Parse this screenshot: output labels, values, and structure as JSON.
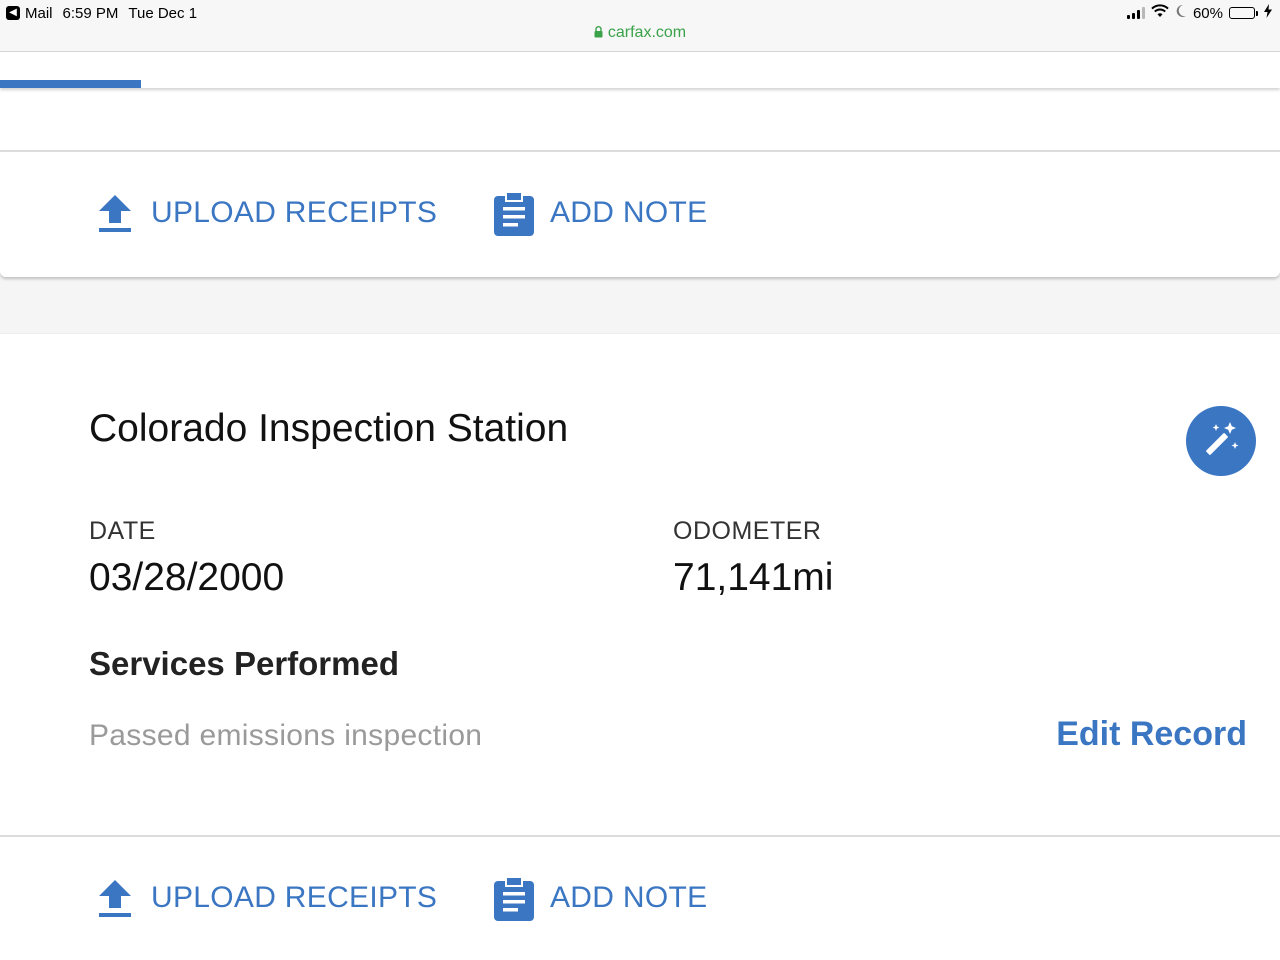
{
  "status_bar": {
    "app": "Mail",
    "time": "6:59 PM",
    "date": "Tue Dec 1",
    "battery": "60%",
    "battery_level": 0.6,
    "url": "carfax.com"
  },
  "progress": {
    "fraction": 0.11
  },
  "actions": {
    "upload_label": "UPLOAD RECEIPTS",
    "note_label": "ADD NOTE"
  },
  "record": {
    "title": "Colorado Inspection Station",
    "date_label": "DATE",
    "date_value": "03/28/2000",
    "odometer_label": "ODOMETER",
    "odometer_value": "71,141mi",
    "services_title": "Services Performed",
    "service_item": "Passed emissions inspection",
    "edit_label": "Edit Record"
  },
  "colors": {
    "accent": "#3b76c3",
    "url_green": "#3aa34a"
  },
  "icons": [
    "back-icon",
    "signal-icon",
    "wifi-icon",
    "moon-icon",
    "battery-icon",
    "charging-icon",
    "lock-icon",
    "upload-icon",
    "clipboard-icon",
    "magic-wand-icon"
  ]
}
